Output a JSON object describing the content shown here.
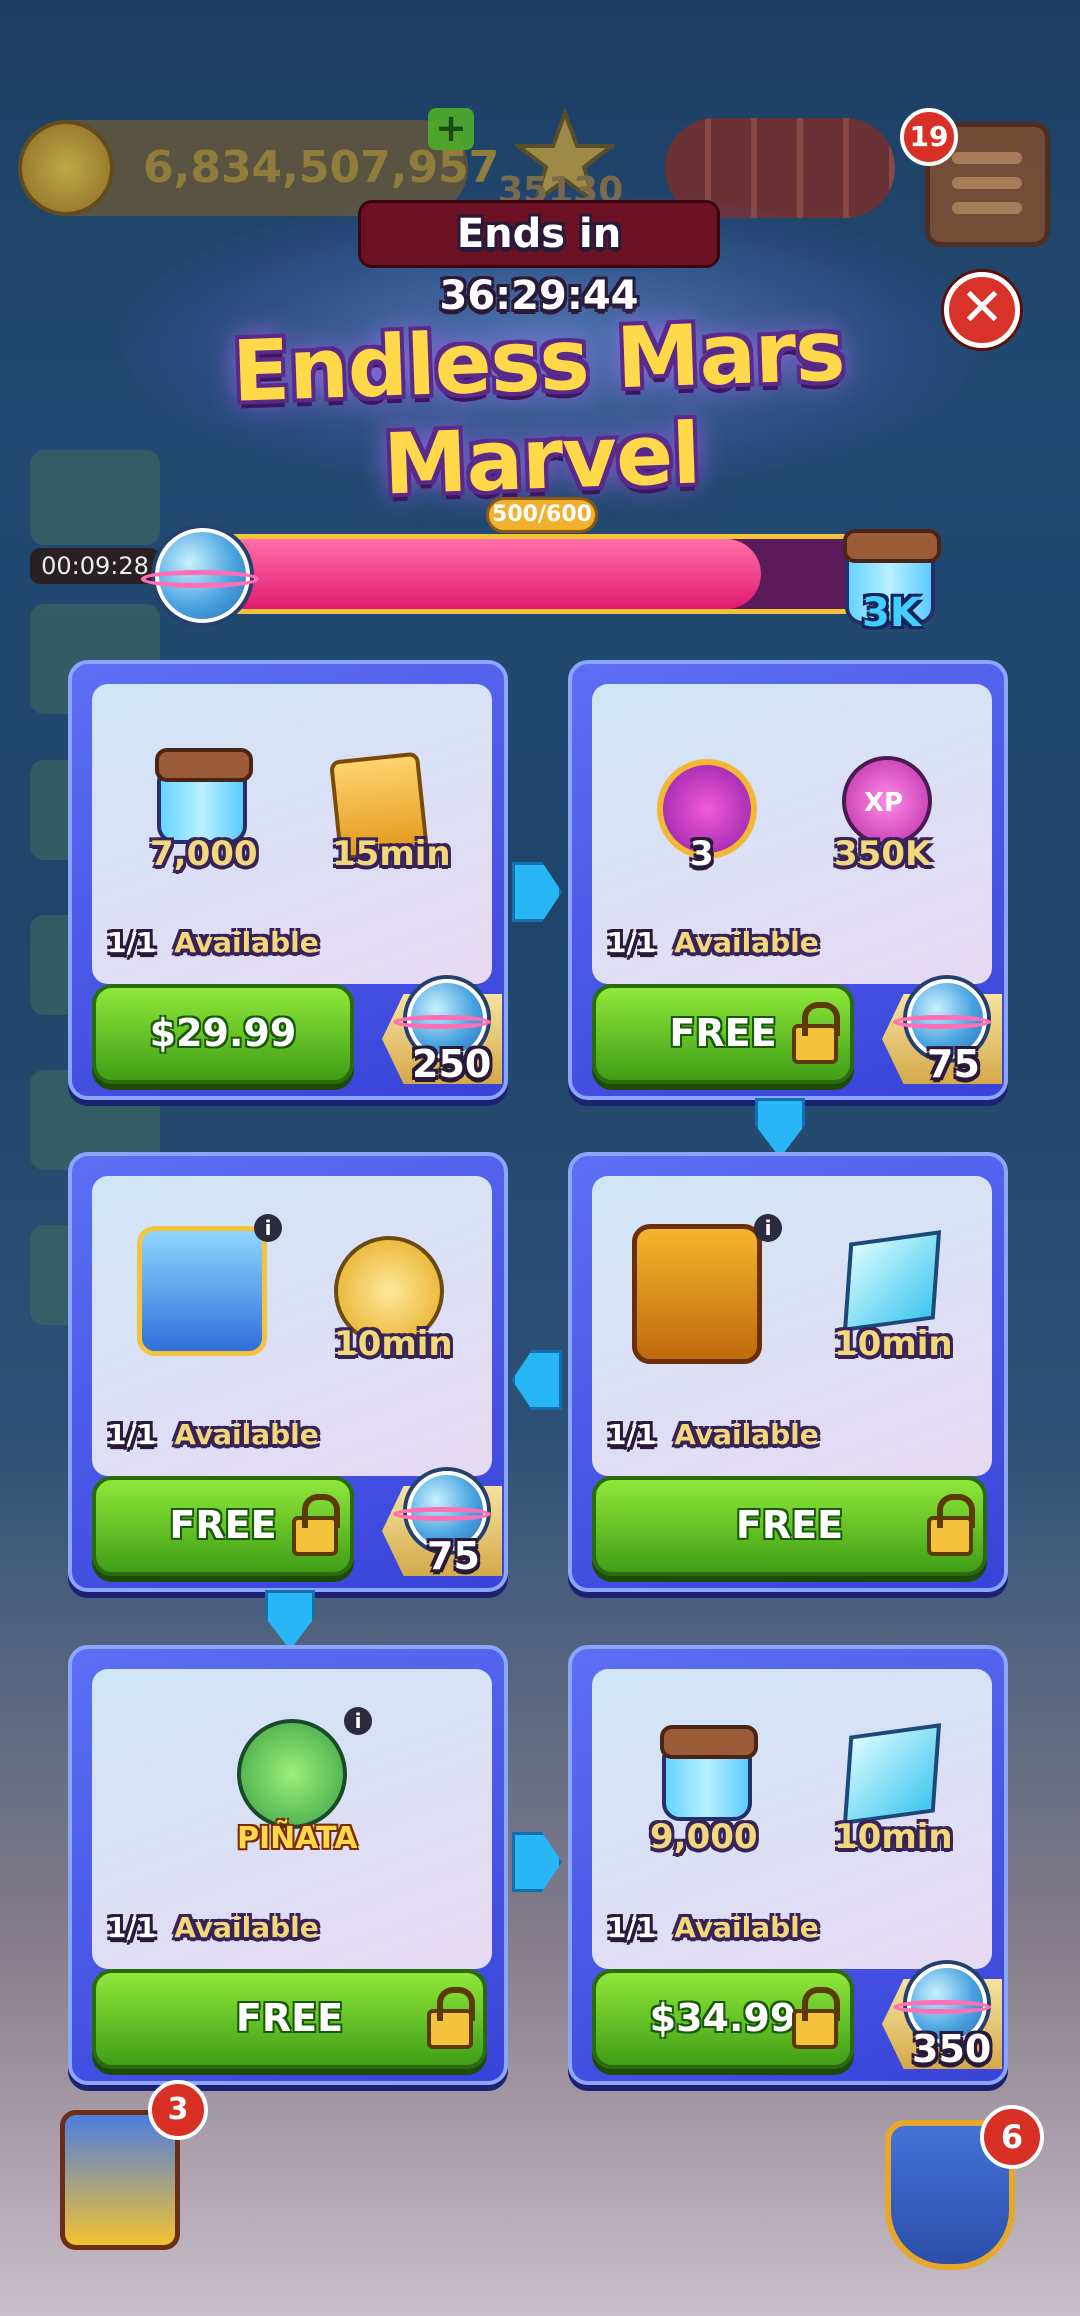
{
  "hud": {
    "coins": "6,834,507,957",
    "plus": "+",
    "stars": "35130",
    "notif_menu": "19"
  },
  "side_event": {
    "timer": "00:09:28"
  },
  "popup": {
    "timer": "Ends in 36:29:44",
    "title": "Endless Mars Marvel",
    "progress_label": "500/600",
    "progress_value": 0.8333,
    "progress_reward": "3K"
  },
  "offers": [
    {
      "items": [
        "7,000",
        "15min"
      ],
      "count": "1/1",
      "availability": "Available",
      "button": "$29.99",
      "points": "250"
    },
    {
      "items": [
        "3",
        "350K"
      ],
      "count": "1/1",
      "availability": "Available",
      "button": "FREE",
      "points": "75"
    },
    {
      "items": [
        "10min"
      ],
      "count": "1/1",
      "availability": "Available",
      "button": "FREE",
      "points": "75"
    },
    {
      "items": [
        "10min"
      ],
      "count": "1/1",
      "availability": "Available",
      "button": "FREE"
    },
    {
      "items": [
        "PIÑATA"
      ],
      "count": "1/1",
      "availability": "Available",
      "button": "FREE"
    },
    {
      "items": [
        "9,000",
        "10min"
      ],
      "count": "1/1",
      "availability": "Available",
      "button": "$34.99",
      "points": "350"
    }
  ],
  "xp_label": "XP",
  "bottom": {
    "left_badge": "3",
    "right_badge": "6"
  },
  "colors": {
    "accent_green": "#3f9e16",
    "card_blue": "#3843d8",
    "progress_pink": "#e01a6e"
  }
}
